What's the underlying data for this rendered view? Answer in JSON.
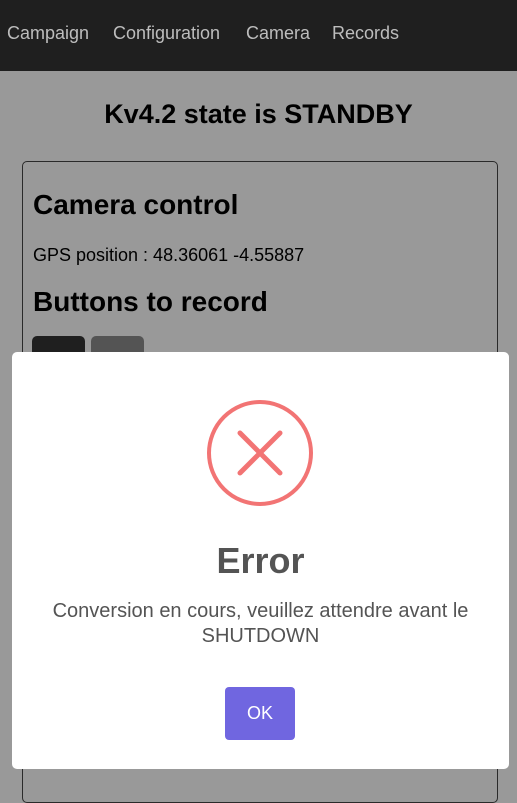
{
  "nav": {
    "items": [
      "Campaign",
      "Configuration",
      "Camera",
      "Records"
    ]
  },
  "page": {
    "title": "Kv4.2 state is STANDBY",
    "card": {
      "heading": "Camera control",
      "gps": "GPS position : 48.36061 -4.55887",
      "buttons_heading": "Buttons to record"
    }
  },
  "dialog": {
    "icon": "error-x-circle-icon",
    "icon_color": "#f27474",
    "title": "Error",
    "message": "Conversion en cours, veuillez attendre avant le SHUTDOWN",
    "ok_label": "OK",
    "ok_color": "#7066e0"
  }
}
